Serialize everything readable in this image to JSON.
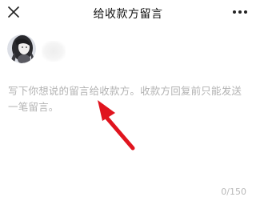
{
  "header": {
    "title": "给收款方留言"
  },
  "recipient": {
    "avatar": "avatar-image"
  },
  "message": {
    "placeholder": "写下你想说的留言给收款方。收款方回复前只能发送一笔留言。"
  },
  "counter": {
    "text": "0/150"
  },
  "annotation": {
    "arrow_color": "#e0141e"
  },
  "colors": {
    "title": "#111111",
    "placeholder": "#b3b3b3"
  },
  "icons": {
    "close": "close-icon",
    "more": "more-icon"
  }
}
